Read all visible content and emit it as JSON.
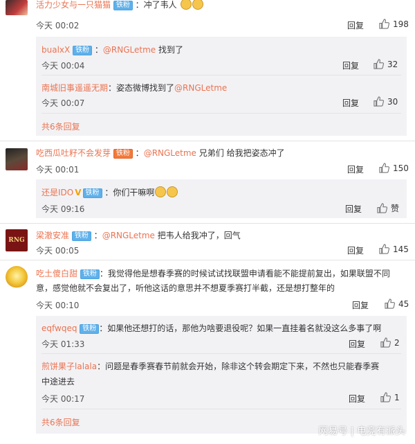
{
  "c1": {
    "username": "活力少女与一只猫猫",
    "badge": "铁粉",
    "text": "：冲了韦人",
    "time": "今天 00:02",
    "reply": "回复",
    "likes": "198"
  },
  "r1": {
    "username": "bualxX",
    "badge": "铁粉",
    "mention": "@RNGLetme",
    "text": "找到了",
    "time": "今天 00:04",
    "reply": "回复",
    "likes": "32"
  },
  "r2": {
    "username": "南城旧事遥遥无期",
    "sep": "：",
    "text": "姿态微博找到了",
    "mention": "@RNGLetme",
    "time": "今天 00:07",
    "reply": "回复",
    "likes": "30"
  },
  "more1": "共6条回复",
  "c2": {
    "username": "吃西瓜吐籽不会发芽",
    "badge": "铁粉",
    "mention": "@RNGLetme",
    "text": "兄弟们 给我把姿态冲了",
    "time": "今天 00:01",
    "reply": "回复",
    "likes": "150"
  },
  "r3": {
    "username": "还是IDO",
    "vmark": "V",
    "badge": "铁粉",
    "text": "：你们干嘛啊",
    "time": "今天 09:16",
    "reply": "回复",
    "likes": "赞"
  },
  "c3": {
    "username": "梁澈安准",
    "badge": "铁粉",
    "mention": "@RNGLetme",
    "text": "把韦人给我冲了，回气",
    "time": "今天 00:05",
    "reply": "回复",
    "likes": "145",
    "avatar_text": "RNG"
  },
  "c4": {
    "username": "吃土傻白甜",
    "badge": "铁粉",
    "text_line1": "：我觉得他是想春季赛的时候试试找联盟申请看能不能提前复出，如果联盟不同",
    "text_line2": "意，感觉他就不会复出了，听他这话的意思并不想夏季赛打半截，还是想打整年的",
    "time": "今天 00:10",
    "reply": "回复",
    "likes": "45"
  },
  "r4": {
    "username": "eqfwqeq",
    "badge": "铁粉",
    "text": "：如果他还想打的话，那他为啥要退役呢？如果一直挂着名就没这么多事了啊",
    "time": "今天 01:33",
    "reply": "回复",
    "likes": "2"
  },
  "r5": {
    "username": "煎饼果子lalala",
    "text_line1": "：问题是春季赛春节前就会开始，除非这个转会期定下来，不然也只能春季赛",
    "text_line2": "中途进去",
    "time": "今天 00:17",
    "reply": "回复",
    "likes": "1"
  },
  "more2": "共6条回复",
  "watermark": "网易号 | 电竞有派头",
  "colors": {
    "username": "#eb7350",
    "badge": "#5fb0ea",
    "reply_bg": "#f2f2f5"
  }
}
